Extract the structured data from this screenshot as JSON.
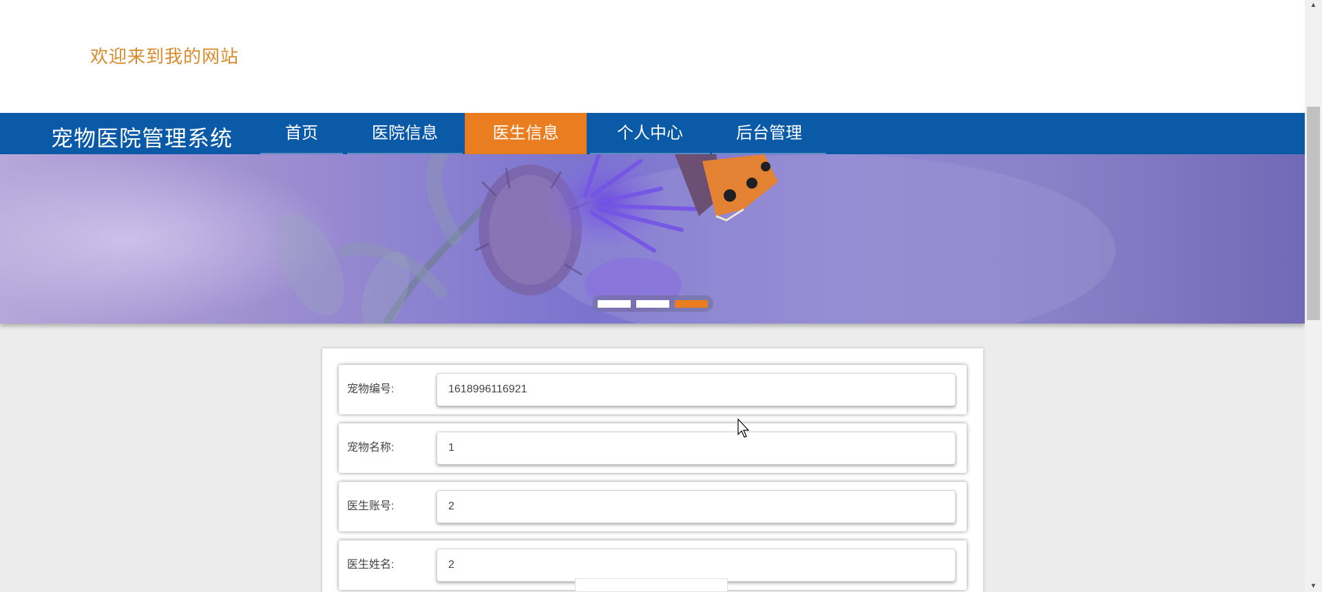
{
  "header": {
    "welcome_text": "欢迎来到我的网站"
  },
  "navbar": {
    "brand": "宠物医院管理系统",
    "items": [
      {
        "label": "首页",
        "active": false
      },
      {
        "label": "医院信息",
        "active": false
      },
      {
        "label": "医生信息",
        "active": true
      },
      {
        "label": "个人中心",
        "active": false
      },
      {
        "label": "后台管理",
        "active": false
      }
    ]
  },
  "banner": {
    "slide_count": 3,
    "active_slide": 3
  },
  "form": {
    "fields": [
      {
        "label": "宠物编号:",
        "value": "1618996116921"
      },
      {
        "label": "宠物名称:",
        "value": "1"
      },
      {
        "label": "医生账号:",
        "value": "2"
      },
      {
        "label": "医生姓名:",
        "value": "2"
      }
    ]
  },
  "colors": {
    "brand_blue": "#0a5aa8",
    "accent_orange": "#e97d1f",
    "welcome_orange": "#d98a2b"
  },
  "icons": {
    "scroll_up": "▲",
    "scroll_down": "▼"
  }
}
